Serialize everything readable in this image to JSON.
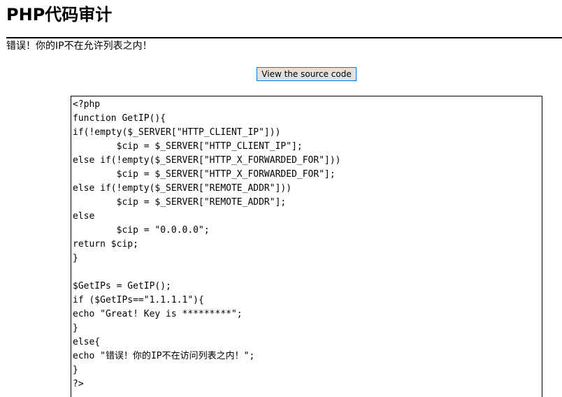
{
  "header": {
    "title": "PHP代码审计"
  },
  "message": {
    "error": "错误！你的IP不在允许列表之内！"
  },
  "actions": {
    "view_source_label": "View the source code"
  },
  "source": {
    "lines": [
      "<?php",
      "function GetIP(){",
      "if(!empty($_SERVER[\"HTTP_CLIENT_IP\"]))",
      "        $cip = $_SERVER[\"HTTP_CLIENT_IP\"];",
      "else if(!empty($_SERVER[\"HTTP_X_FORWARDED_FOR\"]))",
      "        $cip = $_SERVER[\"HTTP_X_FORWARDED_FOR\"];",
      "else if(!empty($_SERVER[\"REMOTE_ADDR\"]))",
      "        $cip = $_SERVER[\"REMOTE_ADDR\"];",
      "else",
      "        $cip = \"0.0.0.0\";",
      "return $cip;",
      "}",
      "",
      "$GetIPs = GetIP();",
      "if ($GetIPs==\"1.1.1.1\"){",
      "echo \"Great! Key is *********\";",
      "}",
      "else{",
      "echo \"错误！你的IP不在访问列表之内！\";",
      "}",
      "?>"
    ]
  }
}
